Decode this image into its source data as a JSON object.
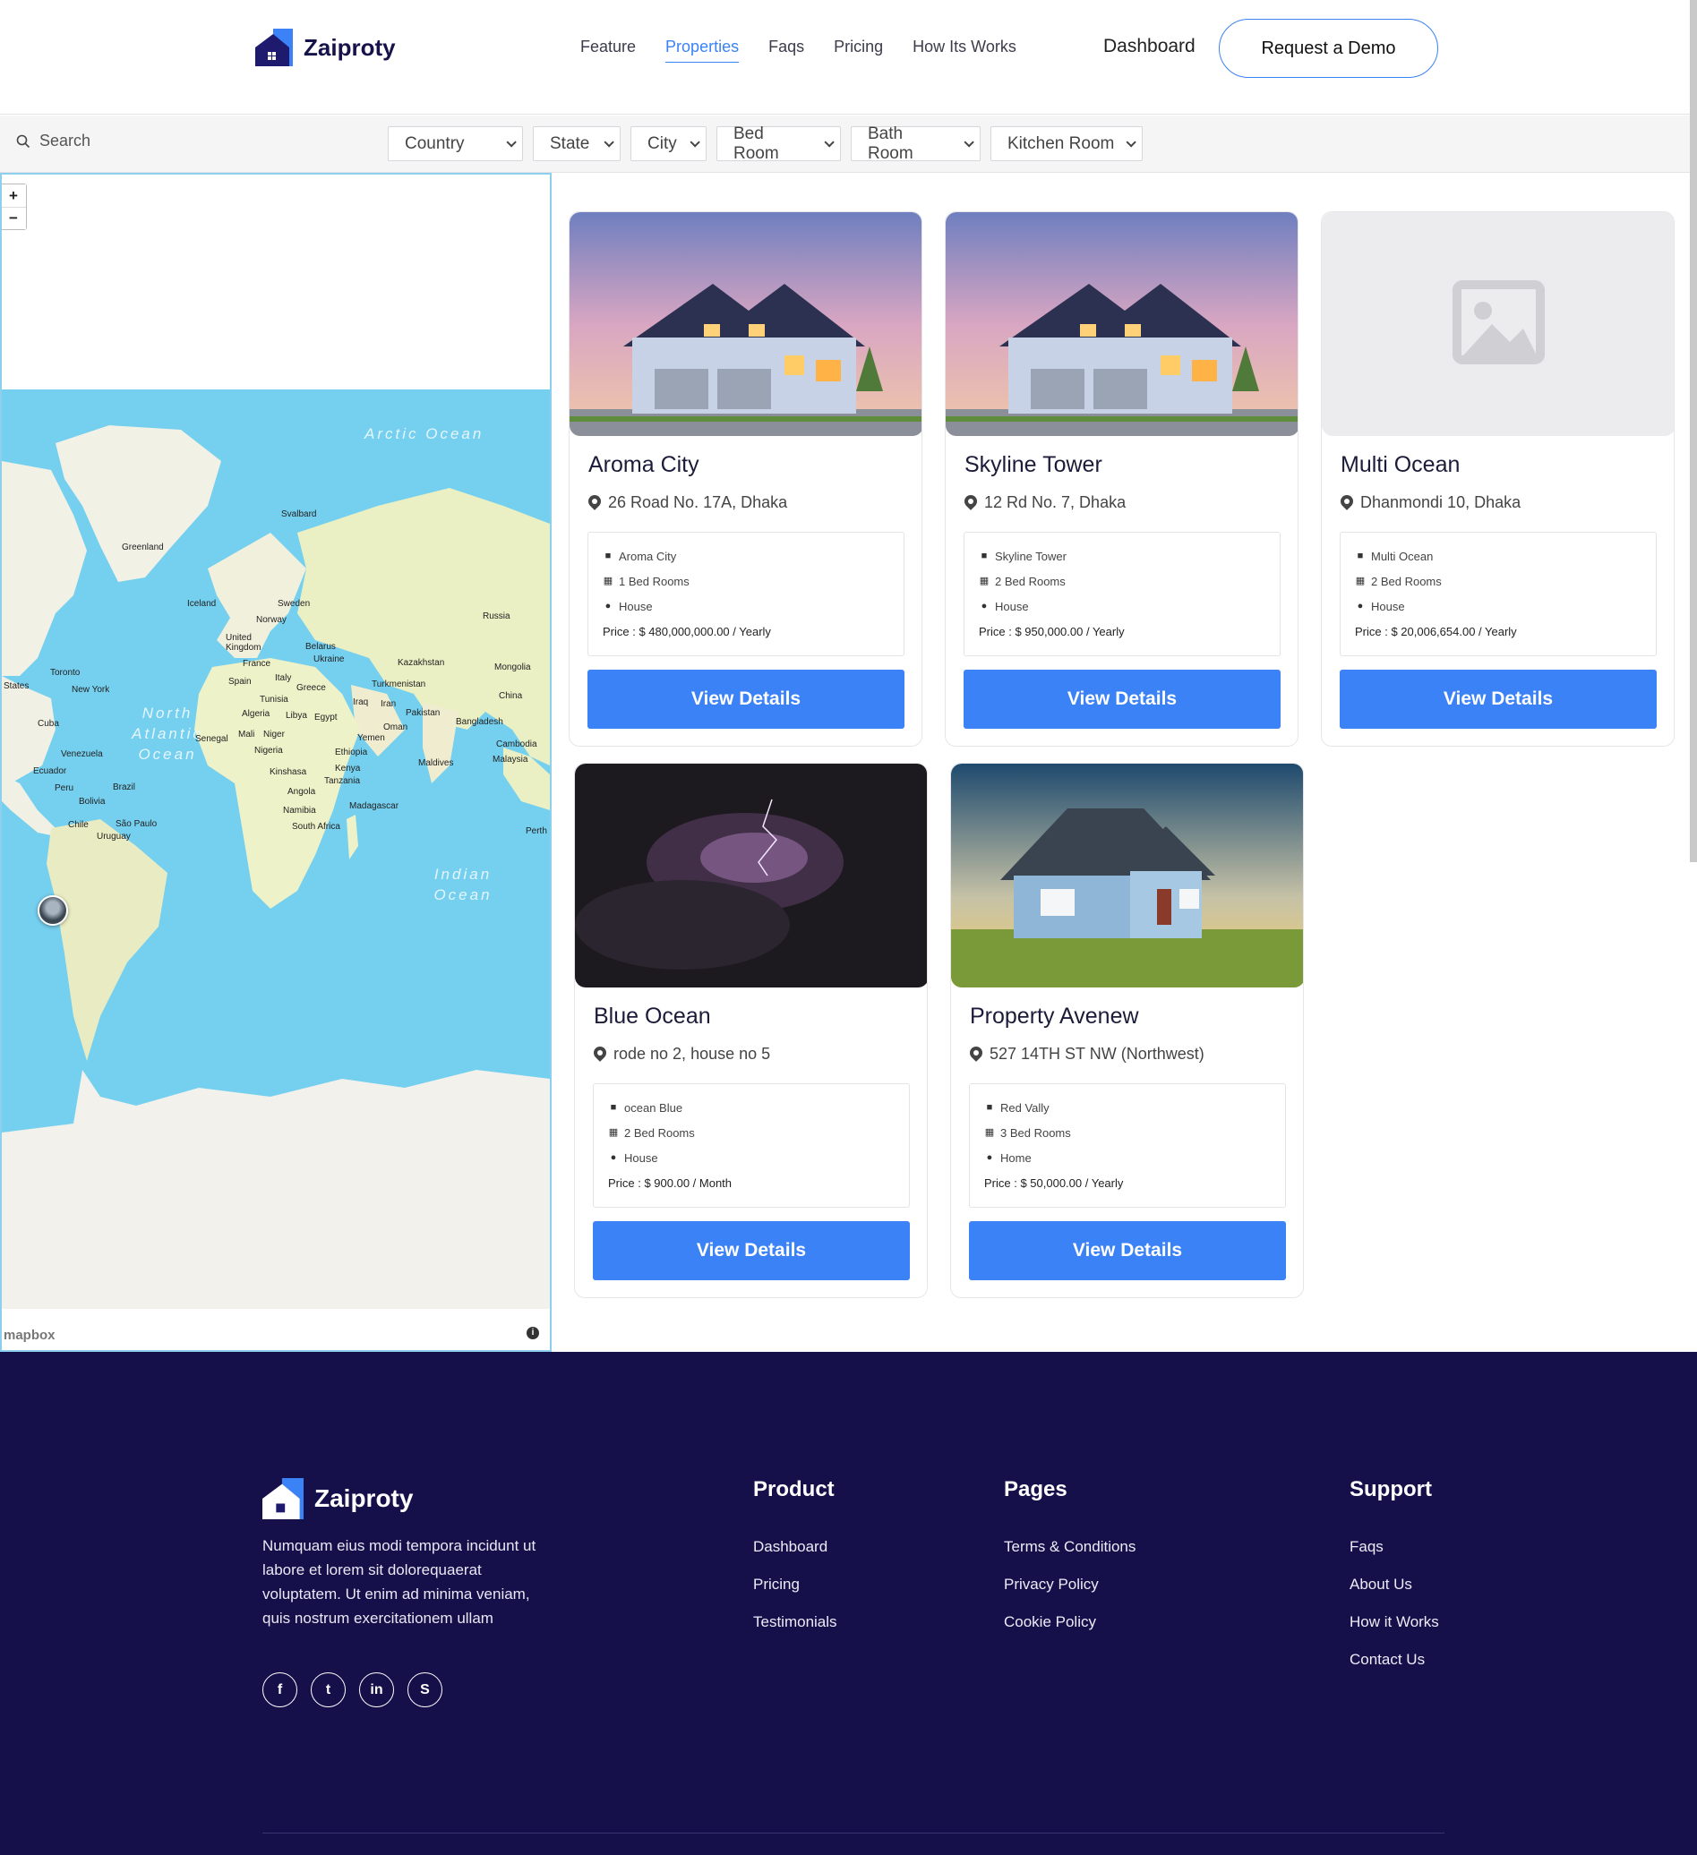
{
  "brand": {
    "name": "Zaiproty",
    "primary": "#3b82f6",
    "dark": "#150f4a"
  },
  "header": {
    "nav": [
      "Feature",
      "Properties",
      "Faqs",
      "Pricing",
      "How Its Works"
    ],
    "active_nav": "Properties",
    "dashboard": "Dashboard",
    "demo_button": "Request a Demo"
  },
  "filters": {
    "search_placeholder": "Search",
    "selects": [
      "Country",
      "State",
      "City",
      "Bed Room",
      "Bath Room",
      "Kitchen Room"
    ]
  },
  "map": {
    "zoom_in": "+",
    "zoom_out": "−",
    "oceans": [
      "Arctic Ocean",
      "North Atlantic Ocean",
      "Indian Ocean"
    ],
    "places": [
      "Svalbard",
      "Greenland",
      "Iceland",
      "Sweden",
      "Norway",
      "Russia",
      "United Kingdom",
      "Belarus",
      "Ukraine",
      "France",
      "Kazakhstan",
      "Mongolia",
      "Toronto",
      "New York",
      "States",
      "Spain",
      "Italy",
      "Greece",
      "Turkmenistan",
      "China",
      "Tunisia",
      "Iraq",
      "Iran",
      "Algeria",
      "Libya",
      "Egypt",
      "Pakistan",
      "Bangladesh",
      "Cuba",
      "Oman",
      "Senegal",
      "Mali",
      "Niger",
      "Yemen",
      "Cambodia",
      "Venezuela",
      "Nigeria",
      "Ethiopia",
      "Maldives",
      "Malaysia",
      "Ecuador",
      "Kinshasa",
      "Kenya",
      "Tanzania",
      "Peru",
      "Brazil",
      "Angola",
      "Bolivia",
      "Madagascar",
      "Namibia",
      "Chile",
      "São Paulo",
      "South Africa",
      "Uruguay",
      "Perth"
    ],
    "attribution": "mapbox",
    "info": "i"
  },
  "properties": [
    {
      "title": "Aroma City",
      "address": "26 Road No. 17A, Dhaka",
      "name": "Aroma City",
      "beds": "1 Bed Rooms",
      "type": "House",
      "price": "Price : $ 480,000,000.00 / Yearly",
      "button": "View Details"
    },
    {
      "title": "Skyline Tower",
      "address": "12 Rd No. 7, Dhaka",
      "name": "Skyline Tower",
      "beds": "2 Bed Rooms",
      "type": "House",
      "price": "Price : $ 950,000.00 / Yearly",
      "button": "View Details"
    },
    {
      "title": "Multi Ocean",
      "address": "Dhanmondi 10, Dhaka",
      "name": "Multi Ocean",
      "beds": "2 Bed Rooms",
      "type": "House",
      "price": "Price : $ 20,006,654.00 / Yearly",
      "button": "View Details"
    },
    {
      "title": "Blue Ocean",
      "address": "rode no 2, house no 5",
      "name": "ocean Blue",
      "beds": "2 Bed Rooms",
      "type": "House",
      "price": "Price : $ 900.00 / Month",
      "button": "View Details"
    },
    {
      "title": "Property Avenew",
      "address": "527 14TH ST NW (Northwest)",
      "name": "Red Vally",
      "beds": "3 Bed Rooms",
      "type": "Home",
      "price": "Price : $ 50,000.00 / Yearly",
      "button": "View Details"
    }
  ],
  "footer": {
    "brand": "Zaiproty",
    "description": "Numquam eius modi tempora incidunt ut labore et lorem sit dolorequaerat voluptatem. Ut enim ad minima veniam, quis nostrum exercitationem ullam",
    "socials": [
      "f",
      "t",
      "in",
      "S"
    ],
    "columns": [
      {
        "title": "Product",
        "links": [
          "Dashboard",
          "Pricing",
          "Testimonials"
        ]
      },
      {
        "title": "Pages",
        "links": [
          "Terms & Conditions",
          "Privacy Policy",
          "Cookie Policy"
        ]
      },
      {
        "title": "Support",
        "links": [
          "Faqs",
          "About Us",
          "How it Works",
          "Contact Us"
        ]
      }
    ]
  }
}
